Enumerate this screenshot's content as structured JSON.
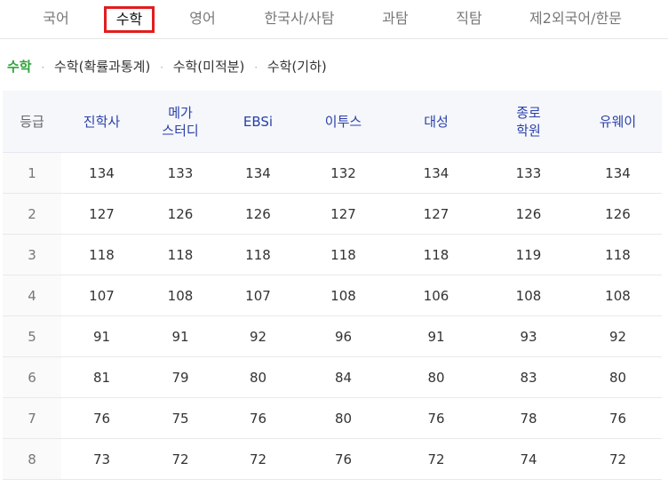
{
  "top_tabs": [
    {
      "label": "국어",
      "active": false
    },
    {
      "label": "수학",
      "active": true
    },
    {
      "label": "영어",
      "active": false
    },
    {
      "label": "한국사/사탐",
      "active": false
    },
    {
      "label": "과탐",
      "active": false
    },
    {
      "label": "직탐",
      "active": false
    },
    {
      "label": "제2외국어/한문",
      "active": false
    }
  ],
  "sub_tabs": [
    {
      "label": "수학",
      "active": true
    },
    {
      "label": "수학(확률과통계)",
      "active": false
    },
    {
      "label": "수학(미적분)",
      "active": false
    },
    {
      "label": "수학(기하)",
      "active": false
    }
  ],
  "sub_separator": "·",
  "table": {
    "grade_header": "등급",
    "columns": [
      {
        "line1": "진학사",
        "line2": ""
      },
      {
        "line1": "메가",
        "line2": "스터디"
      },
      {
        "line1": "EBSi",
        "line2": ""
      },
      {
        "line1": "이투스",
        "line2": ""
      },
      {
        "line1": "대성",
        "line2": ""
      },
      {
        "line1": "종로",
        "line2": "학원"
      },
      {
        "line1": "유웨이",
        "line2": ""
      }
    ],
    "rows": [
      {
        "grade": "1",
        "values": [
          "134",
          "133",
          "134",
          "132",
          "134",
          "133",
          "134"
        ]
      },
      {
        "grade": "2",
        "values": [
          "127",
          "126",
          "126",
          "127",
          "127",
          "126",
          "126"
        ]
      },
      {
        "grade": "3",
        "values": [
          "118",
          "118",
          "118",
          "118",
          "118",
          "119",
          "118"
        ]
      },
      {
        "grade": "4",
        "values": [
          "107",
          "108",
          "107",
          "108",
          "106",
          "108",
          "108"
        ]
      },
      {
        "grade": "5",
        "values": [
          "91",
          "91",
          "92",
          "96",
          "91",
          "93",
          "92"
        ]
      },
      {
        "grade": "6",
        "values": [
          "81",
          "79",
          "80",
          "84",
          "80",
          "83",
          "80"
        ]
      },
      {
        "grade": "7",
        "values": [
          "76",
          "75",
          "76",
          "80",
          "76",
          "78",
          "76"
        ]
      },
      {
        "grade": "8",
        "values": [
          "73",
          "72",
          "72",
          "76",
          "72",
          "74",
          "72"
        ]
      }
    ]
  },
  "colors": {
    "active_tab_border": "#e11d1d",
    "active_subtab": "#2fa43a",
    "column_header_text": "#2a3fa8",
    "header_background": "#f5f7fb"
  }
}
